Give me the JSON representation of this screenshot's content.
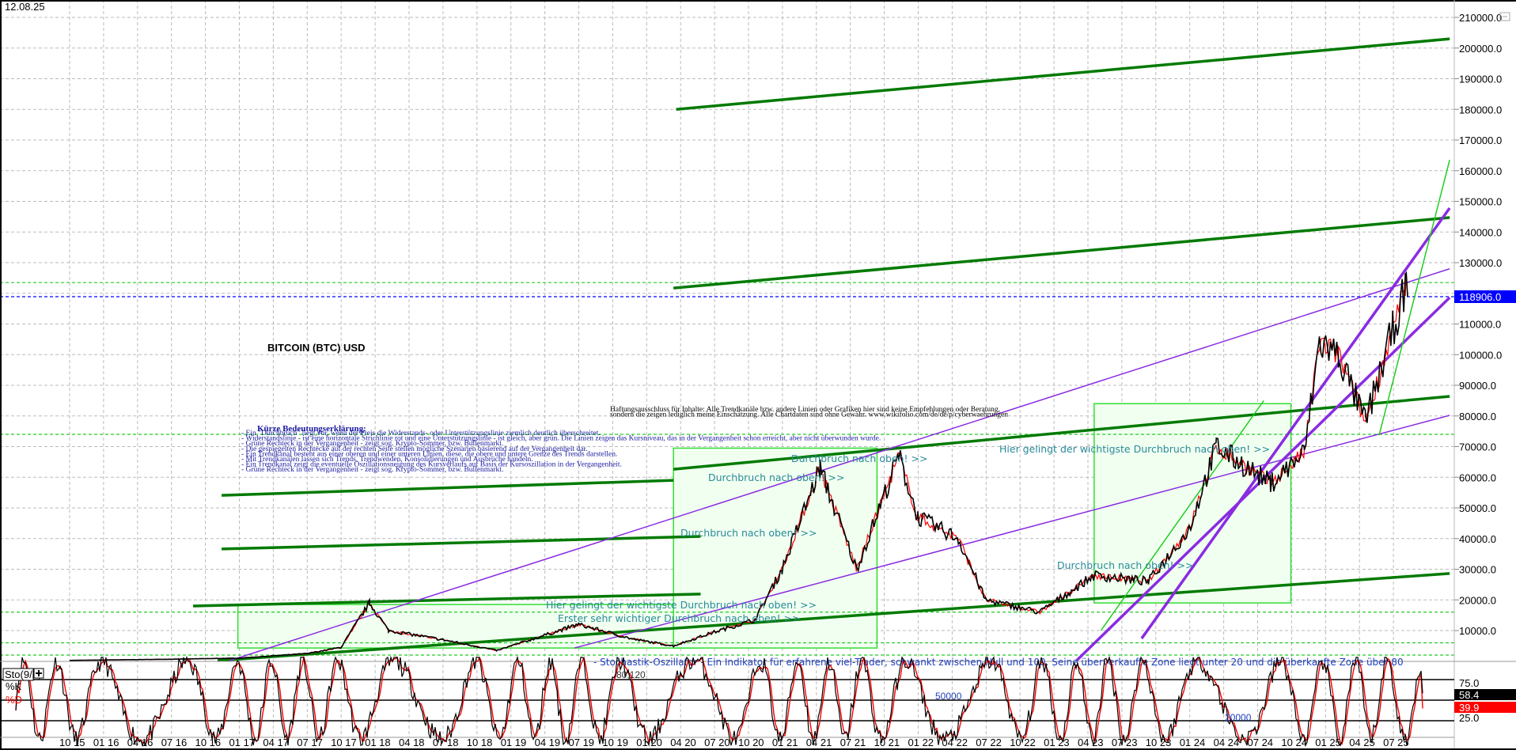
{
  "header": {
    "date": "12.08.25"
  },
  "chart_data": {
    "type": "line",
    "title": "BITCOIN (BTC) USD",
    "xlabel": "",
    "ylabel": "",
    "ylim": [
      0,
      215000
    ],
    "xlim": [
      "2015-08",
      "2025-12"
    ],
    "grid": true,
    "y_ticks": [
      10000,
      20000,
      30000,
      40000,
      50000,
      60000,
      70000,
      80000,
      90000,
      100000,
      110000,
      120000,
      130000,
      140000,
      150000,
      160000,
      170000,
      180000,
      190000,
      200000,
      210000
    ],
    "x_tick_labels": [
      "10 15",
      "01 16",
      "04 16",
      "07 16",
      "10 16",
      "01 17",
      "04 17",
      "07 17",
      "10 17",
      "01 18",
      "04 18",
      "07 18",
      "10 18",
      "01 19",
      "04 19",
      "07 19",
      "10 19",
      "01 20",
      "04 20",
      "07 20",
      "10 20",
      "01 21",
      "04 21",
      "07 21",
      "10 21",
      "01 22",
      "04 22",
      "07 22",
      "10 22",
      "01 23",
      "04 23",
      "07 23",
      "10 23",
      "01 24",
      "04 24",
      "07 24",
      "10 24",
      "01 25",
      "04 25",
      "07 25"
    ],
    "last_price": 118906.0,
    "last_price_label": "118906.0",
    "price_series": {
      "x": [
        2015.75,
        2016.5,
        2017.0,
        2017.5,
        2017.75,
        2017.96,
        2018.1,
        2018.5,
        2018.9,
        2019.5,
        2019.9,
        2020.2,
        2020.5,
        2020.8,
        2021.0,
        2021.28,
        2021.55,
        2021.86,
        2022.0,
        2022.3,
        2022.5,
        2022.9,
        2023.3,
        2023.7,
        2024.0,
        2024.2,
        2024.6,
        2024.85,
        2024.96,
        2025.1,
        2025.3,
        2025.5,
        2025.6,
        2025.61
      ],
      "y": [
        250,
        650,
        1000,
        2500,
        4500,
        19000,
        10000,
        7000,
        3500,
        12000,
        7200,
        5000,
        9500,
        13500,
        30000,
        63000,
        30000,
        67000,
        47000,
        40000,
        20000,
        16000,
        28000,
        26000,
        43000,
        70000,
        58000,
        68000,
        104000,
        100000,
        78000,
        108000,
        122000,
        118906
      ]
    },
    "trendlines": [
      {
        "color": "#007a00",
        "style": "thick",
        "x": [
          2020.22,
          2025.92
        ],
        "y": [
          180000,
          203000
        ]
      },
      {
        "color": "#007a00",
        "style": "thick",
        "x": [
          2020.2,
          2025.92
        ],
        "y": [
          121700,
          144700
        ]
      },
      {
        "color": "#007a00",
        "style": "thick",
        "x": [
          2020.2,
          2025.92
        ],
        "y": [
          62600,
          86400
        ]
      },
      {
        "color": "#007a00",
        "style": "thick",
        "x": [
          2016.87,
          2020.2
        ],
        "y": [
          54100,
          59000
        ]
      },
      {
        "color": "#007a00",
        "style": "thick",
        "x": [
          2016.87,
          2020.4
        ],
        "y": [
          36600,
          40700
        ]
      },
      {
        "color": "#007a00",
        "style": "thick",
        "x": [
          2016.66,
          2020.4
        ],
        "y": [
          18000,
          21900
        ]
      },
      {
        "color": "#007a00",
        "style": "thick",
        "x": [
          2016.84,
          2025.92
        ],
        "y": [
          200,
          28600
        ]
      },
      {
        "color": "#8a2be2",
        "style": "thin",
        "x": [
          2016.93,
          2025.92
        ],
        "y": [
          200,
          128000
        ]
      },
      {
        "color": "#8a2be2",
        "style": "thin",
        "x": [
          2019.47,
          2025.92
        ],
        "y": [
          4300,
          80200
        ]
      },
      {
        "color": "#8a2be2",
        "style": "thick",
        "x": [
          2023.65,
          2025.92
        ],
        "y": [
          7400,
          147800
        ]
      },
      {
        "color": "#8a2be2",
        "style": "thick",
        "x": [
          2023.17,
          2025.92
        ],
        "y": [
          200,
          118600
        ]
      },
      {
        "color": "#22cc22",
        "style": "thin",
        "x": [
          2025.4,
          2025.92
        ],
        "y": [
          73700,
          163500
        ]
      },
      {
        "color": "#22cc22",
        "style": "thin",
        "x": [
          2023.35,
          2024.55
        ],
        "y": [
          10000,
          85000
        ]
      }
    ],
    "horizontal_levels": [
      {
        "color": "#0000ff",
        "value": 118906
      },
      {
        "color": "#22cc22",
        "value": 123500
      },
      {
        "color": "#22cc22",
        "value": 74000
      },
      {
        "color": "#22cc22",
        "value": 16000
      },
      {
        "color": "#22cc22",
        "value": 6000
      },
      {
        "color": "#22cc22",
        "value": 2000
      }
    ],
    "rectangles": [
      {
        "x": [
          2016.99,
          2020.4
        ],
        "y": [
          4300,
          18500
        ]
      },
      {
        "x": [
          2020.2,
          2021.7
        ],
        "y": [
          4300,
          69500
        ]
      },
      {
        "x": [
          2023.3,
          2024.75
        ],
        "y": [
          19000,
          84000
        ]
      }
    ],
    "annotations": {
      "breakout": "Durchbruch nach oben! >>",
      "key_breakout": "Hier gelingt der wichtigste Durchbruch nach oben! >>",
      "first_breakout": "Erster sehr wichtiger Durchbruch nach oben! >>",
      "stoch_note": "- Stochastik-Oszillator - Ein Indikator  für erfahrene viel-Trader, schwankt zwischen Null und 100. Seine überverkaufte Zone  liegt unter 20 und die überkaufte Zone  über 80",
      "stoch_num1": "80,120",
      "stoch_num2": "50000",
      "stoch_num3": "20000"
    },
    "legend_box": {
      "heading": "Kürze Bedeutungserklärung:",
      "lines": [
        "- Ein \"Durchbruch\" liegt vor, wenn der Preis die Widerstands- oder Unterstützungslinie ziemlich deutlich überschreitet.",
        "- Widerstandslinie - ist eine horizontale Strichlinie rot und eine Unterstützungslinie - ist gleich, aber grün. Die Linien zeigen das Kursniveau, das in der Vergangenheit schon erreicht, aber nicht überwunden wurde.",
        "- Grüne Rechteck in der Vergangenheit - zeigt sog. Krypto-Sommer, bzw. Bullenmarkt.",
        "- Die gespiegelten Rechtecke auf der rechten Seite stellen mögliche Szenarien basierend auf der Vergangenheit dar.",
        "- Ein Trendkanal besteht aus einer oberen und einer unteren Linien, diese, die obere und untere Grenze des Trends darstellen.",
        "- Mit Trendkanälen lassen sich Trends, Trendwenden, Konsolidierungen und Ausbrüche handeln.",
        " - Ein Trendkanal  zeigt die eventuelle Oszillationsneigung  des Kursverlaufs  auf Basis der Kursoszillation in der Vergangenheit.",
        " - Grüne Rechteck in der Vergangenheit - zeigt sog. Krypto-Sommer, bzw. Bullenmarkt."
      ]
    },
    "disclaimer": [
      "Haftungsausschluss für Inhalte: Alle Trendkanäle bzw. andere Linien oder Grafiken hier sind keine Empfehlungen oder Beratung,",
      "sondern die zeigen lediglich meine  Einschätzung. Alle Chartdaten sind ohne Gewähr.  www.wikifolio.com/de/de/p/cyberwaehrungen"
    ],
    "stochastic": {
      "label": "Sto(9/5)",
      "k_label": "%K",
      "d_label": "%D",
      "k_value": 58.4,
      "d_value": 39.9,
      "k_value_label": "58.4",
      "d_value_label": "39.9",
      "levels": [
        75,
        50,
        25
      ],
      "level_labels": [
        "75.0",
        "25.0"
      ],
      "ylim": [
        0,
        100
      ],
      "k_color": "#000000",
      "d_color": "#ff0000"
    },
    "colors": {
      "price_up": "#000000",
      "price_down": "#ff0000",
      "last_price_bg": "#0000ff",
      "grid": "#bbbbbb",
      "rect_fill": "#f0fff0",
      "rect_stroke": "#33dd33"
    }
  }
}
